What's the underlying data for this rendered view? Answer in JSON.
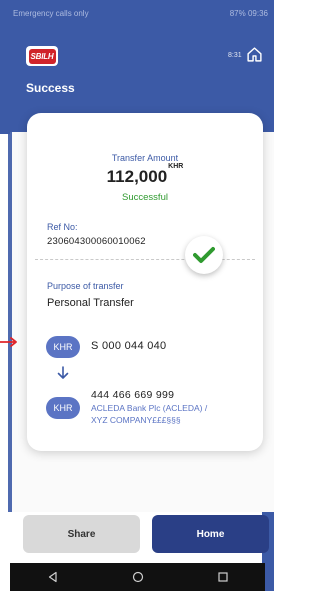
{
  "status_bar": {
    "left_text": "Emergency calls only",
    "right_text": "87% 09:36"
  },
  "header": {
    "logo_text": "SBILH",
    "code": "8:31",
    "title": "Success"
  },
  "transfer": {
    "amount_label": "Transfer Amount",
    "amount": "112,000",
    "currency_sup": "KHR",
    "status": "Successful",
    "ref_label": "Ref No:",
    "ref_value": "230604300060010062",
    "purpose_label": "Purpose of transfer",
    "purpose_value": "Personal Transfer",
    "from": {
      "currency": "KHR",
      "account": "S 000 044 040"
    },
    "to": {
      "currency": "KHR",
      "account": "444 466 669 999",
      "bank": "ACLEDA Bank Plc (ACLEDA) /",
      "name": "XYZ COMPANY£££§§§"
    }
  },
  "buttons": {
    "share": "Share",
    "home": "Home"
  },
  "icons": [
    "home-icon",
    "check-icon",
    "arrow-down-icon",
    "back-icon",
    "home-nav-icon",
    "recents-icon"
  ],
  "colors": {
    "brand": "#3c5aa6",
    "success": "#2f9a2f",
    "pill": "#5b74c4",
    "home_button": "#2a3f86"
  }
}
